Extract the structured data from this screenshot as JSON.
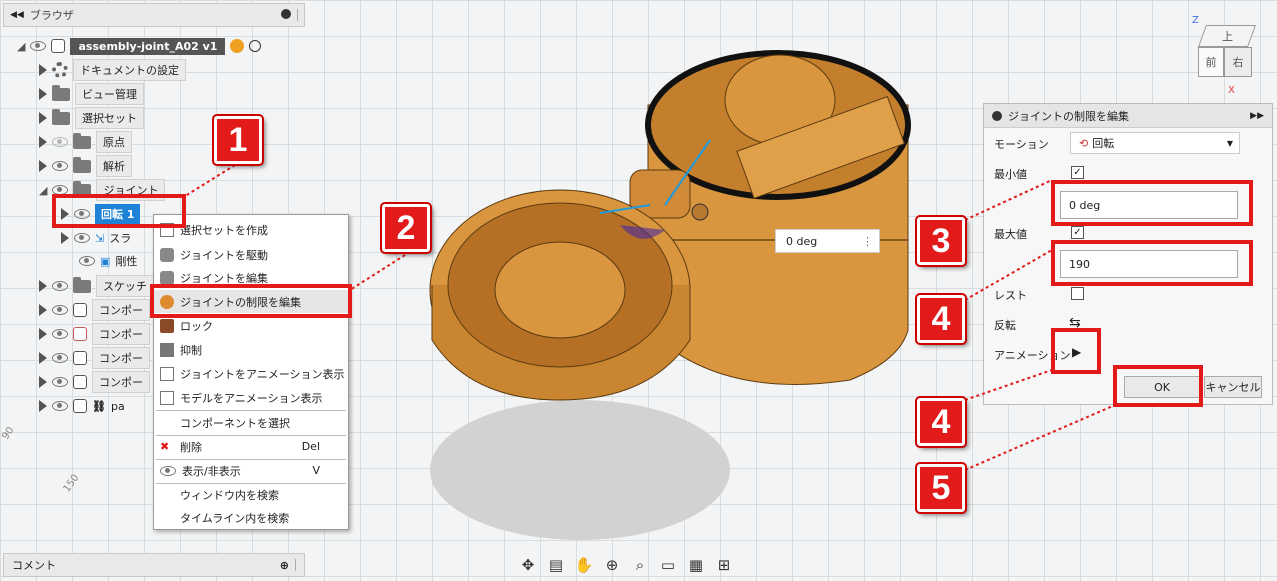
{
  "browser": {
    "title": "ブラウザ",
    "root": "assembly-joint_A02 v1",
    "items": [
      {
        "label": "ドキュメントの設定"
      },
      {
        "label": "ビュー管理"
      },
      {
        "label": "選択セット"
      },
      {
        "label": "原点"
      },
      {
        "label": "解析"
      },
      {
        "label": "ジョイント"
      },
      {
        "label": "回転 1"
      },
      {
        "label": "スラ"
      },
      {
        "label": "剛性"
      },
      {
        "label": "スケッチ"
      },
      {
        "label": "コンポー"
      },
      {
        "label": "コンポー"
      },
      {
        "label": "コンポー"
      },
      {
        "label": "コンポー"
      },
      {
        "label": "pa"
      }
    ]
  },
  "context_menu": {
    "items": [
      {
        "label": "選択セットを作成"
      },
      {
        "label": "ジョイントを駆動"
      },
      {
        "label": "ジョイントを編集"
      },
      {
        "label": "ジョイントの制限を編集"
      },
      {
        "label": "ロック"
      },
      {
        "label": "抑制"
      },
      {
        "label": "ジョイントをアニメーション表示"
      },
      {
        "label": "モデルをアニメーション表示"
      },
      {
        "label": "コンポーネントを選択"
      },
      {
        "label": "削除",
        "shortcut": "Del"
      },
      {
        "label": "表示/非表示",
        "shortcut": "V"
      },
      {
        "label": "ウィンドウ内を検索"
      },
      {
        "label": "タイムライン内を検索"
      }
    ]
  },
  "dialog": {
    "title": "ジョイントの制限を編集",
    "motion_label": "モーション",
    "motion_value": "回転",
    "min_label": "最小値",
    "min_value": "0 deg",
    "max_label": "最大値",
    "max_value": "190",
    "rest_label": "レスト",
    "flip_label": "反転",
    "animation_label": "アニメーション",
    "ok_label": "OK",
    "cancel_label": "キャンセル"
  },
  "viewport": {
    "deg_popup": "0 deg",
    "viewcube": {
      "top": "上",
      "front": "前",
      "right": "右",
      "axis_z": "Z",
      "axis_x": "X"
    },
    "ruler": {
      "a": "150",
      "b": "90"
    }
  },
  "comment_panel": {
    "title": "コメント"
  },
  "callouts": [
    "1",
    "2",
    "3",
    "4",
    "4",
    "5"
  ],
  "colors": {
    "callout": "#e21a1a",
    "selection": "#1e82d7",
    "model": "#d9963f"
  }
}
